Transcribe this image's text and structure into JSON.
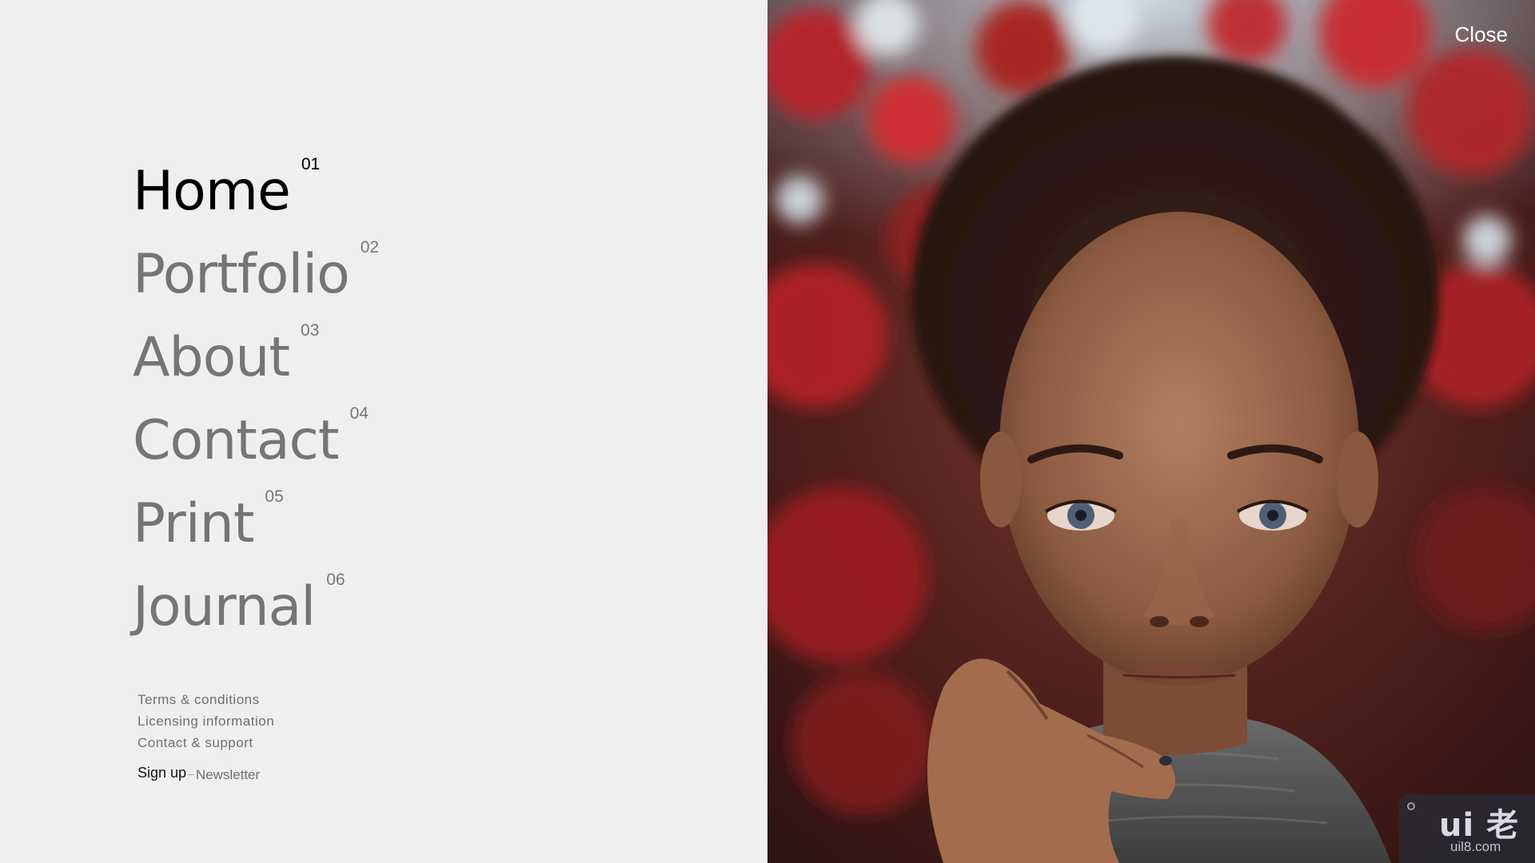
{
  "nav": {
    "items": [
      {
        "label": "Home",
        "num": "01"
      },
      {
        "label": "Portfolio",
        "num": "02"
      },
      {
        "label": "About",
        "num": "03"
      },
      {
        "label": "Contact",
        "num": "04"
      },
      {
        "label": "Print",
        "num": "05"
      },
      {
        "label": "Journal",
        "num": "06"
      }
    ],
    "active_index": 0
  },
  "footer": {
    "links": [
      {
        "label": "Terms & conditions"
      },
      {
        "label": "Licensing information"
      },
      {
        "label": "Contact & support"
      }
    ],
    "signup_label": "Sign up",
    "dash": "–",
    "newsletter_label": "Newsletter"
  },
  "close_label": "Close",
  "watermark": {
    "logo": "ui 老",
    "url": "uil8.com"
  },
  "colors": {
    "background": "#efefef",
    "active_text": "#000000",
    "inactive_text": "#757575",
    "close_text": "#ffffff"
  }
}
